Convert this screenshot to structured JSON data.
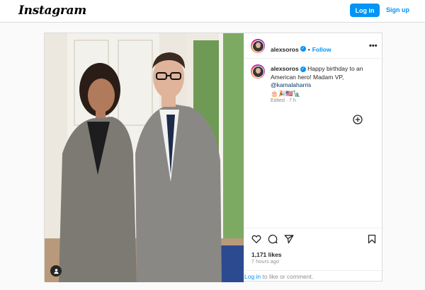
{
  "header": {
    "logo_text": "Instagram",
    "login_label": "Log in",
    "signup_label": "Sign up"
  },
  "post": {
    "author": "alexsoros",
    "verified": true,
    "separator": "•",
    "follow_label": "Follow",
    "more_label": "•••",
    "caption_user": "alexsoros",
    "caption_text": "Happy birthday to an American hero! Madam VP,",
    "caption_mention": "@kamalaharris",
    "caption_emojis": "🎂🎉🇺🇸🗽",
    "edited_label": "Edited · 7 h",
    "likes": "1,171 likes",
    "time_ago": "7 hours ago",
    "footer_login": "Log in",
    "footer_rest": " to like or comment."
  },
  "icons": {
    "user_tag": "person-icon",
    "like": "heart-icon",
    "comment": "comment-icon",
    "share": "paper-plane-icon",
    "save": "bookmark-icon",
    "add_comment": "plus-circle-icon"
  },
  "colors": {
    "accent": "#0095f6",
    "border": "#dbdbdb",
    "text": "#262626",
    "muted": "#8e8e8e"
  }
}
